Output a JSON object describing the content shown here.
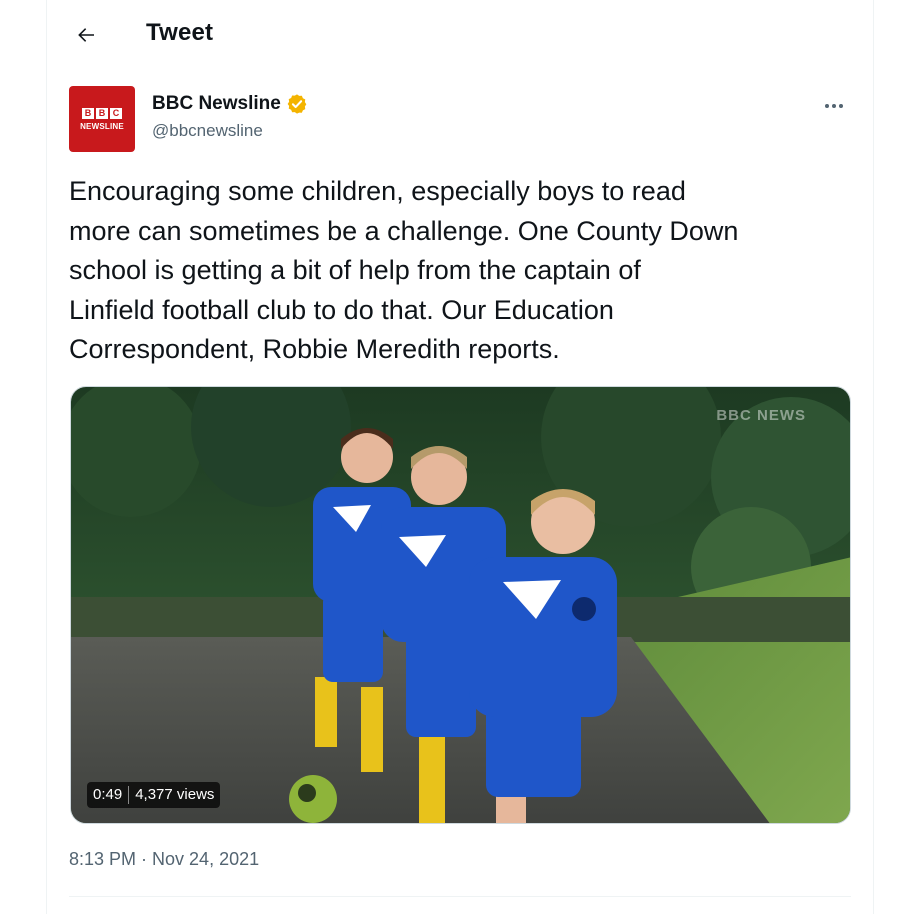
{
  "header": {
    "title": "Tweet",
    "back_icon": "arrow-left-icon"
  },
  "tweet": {
    "author": {
      "display_name": "BBC Newsline",
      "handle": "@bbcnewsline",
      "verified": true,
      "verified_color": "#f4b400",
      "avatar": {
        "logo_letters": [
          "B",
          "B",
          "C"
        ],
        "logo_word": "NEWSLINE",
        "color": "#c8191c"
      }
    },
    "more_icon": "more-horizontal-icon",
    "text": "Encouraging some children, especially boys to read\nmore can sometimes be a challenge. One County Down\nschool is getting a bit of help from the captain of\nLinfield football club to do that. Our Education\nCorrespondent, Robbie Meredith reports.",
    "media": {
      "type": "video",
      "duration": "0:49",
      "views": "4,377 views",
      "watermark": "BBC NEWS"
    },
    "timestamp": "8:13 PM · Nov 24, 2021"
  },
  "colors": {
    "text_primary": "#0f1419",
    "text_secondary": "#536471",
    "divider": "#eff3f4",
    "kit_blue": "#1f56c9"
  }
}
